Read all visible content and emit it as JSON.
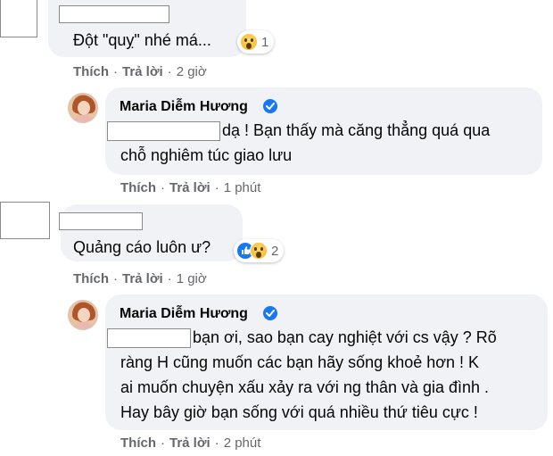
{
  "comments": [
    {
      "text": "Đột \"quỵ\" nhé má...",
      "reaction_count": "1",
      "reactions": [
        "wow-icon"
      ],
      "actions": {
        "like": "Thích",
        "reply": "Trả lời",
        "time": "2 giờ"
      }
    },
    {
      "author": "Maria Diễm Hương",
      "verified": true,
      "lines": [
        "dạ ! Bạn thấy mà căng thẳng quá qua",
        "chỗ nghiêm túc giao lưu"
      ],
      "actions": {
        "like": "Thích",
        "reply": "Trả lời",
        "time": "1 phút"
      }
    },
    {
      "text": "Quảng cáo luôn ư?",
      "reaction_count": "2",
      "reactions": [
        "like-icon",
        "wow-icon"
      ],
      "actions": {
        "like": "Thích",
        "reply": "Trả lời",
        "time": "1 giờ"
      }
    },
    {
      "author": "Maria Diễm Hương",
      "verified": true,
      "lines": [
        "bạn ơi, sao bạn cay nghiệt với cs vậy ? Rõ",
        "ràng H cũng muốn các bạn hãy sống khoẻ hơn ! K",
        "ai muốn chuyện xấu xảy ra với ng thân và gia đình .",
        "Hay bây giờ bạn sống với quá nhiều thứ tiêu cực !"
      ],
      "actions": {
        "like": "Thích",
        "reply": "Trả lời",
        "time": "2 phút"
      }
    }
  ],
  "colors": {
    "bubble": "#f0f2f5",
    "meta": "#65676b",
    "verified": "#1877f2",
    "text": "#050505"
  },
  "separator": "·"
}
